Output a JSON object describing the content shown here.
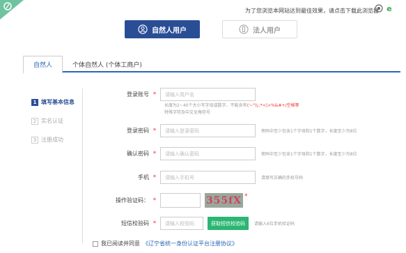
{
  "top_notice": "为了您浏览本网站达到最佳效果，请点击下载此浏览器",
  "user_tabs": [
    {
      "label": "自然人用户"
    },
    {
      "label": "法人用户"
    }
  ],
  "subtabs": [
    {
      "label": "自然人"
    },
    {
      "label": "个体自然人 (个体工商户)"
    }
  ],
  "steps": [
    {
      "num": "1",
      "label": "填写基本信息"
    },
    {
      "num": "2",
      "label": "实名认证"
    },
    {
      "num": "3",
      "label": "注册成功"
    }
  ],
  "form": {
    "account": {
      "label": "登录账号",
      "placeholder": "请输入用户名"
    },
    "account_hint_1_prefix": "长度为2~40个大小写字母或数字、不能含有",
    "account_hint_1_red": "\\'~\"\\\\;:*<|>%&#+/空格等",
    "account_hint_2": "特殊字符及中文全角符号",
    "password": {
      "label": "登录密码",
      "placeholder": "请输入登录密码",
      "hint": "密码中至少包含1个字母和1个数字，长度至少为8位"
    },
    "confirm": {
      "label": "确认密码",
      "placeholder": "请输入确认密码",
      "hint": "密码中至少包含1个字母和1个数字，长度至少为8位"
    },
    "phone": {
      "label": "手机",
      "placeholder": "请输入手机号",
      "hint": "请填写正确的手机号码"
    },
    "captcha": {
      "label": "操作验证码：",
      "image_text": "355fX"
    },
    "sms": {
      "label": "短信校验码",
      "placeholder": "请输入校验码",
      "button": "获取短信校验码",
      "hint": "请输入6位手机验证码"
    },
    "required_mark": "*"
  },
  "agreement": {
    "text": "我已阅读并同意",
    "link": "《辽宁省统一身份认证平台注册协议》"
  },
  "colors": {
    "primary": "#2a4e96",
    "accent": "#2bb673",
    "required": "#e33333"
  }
}
